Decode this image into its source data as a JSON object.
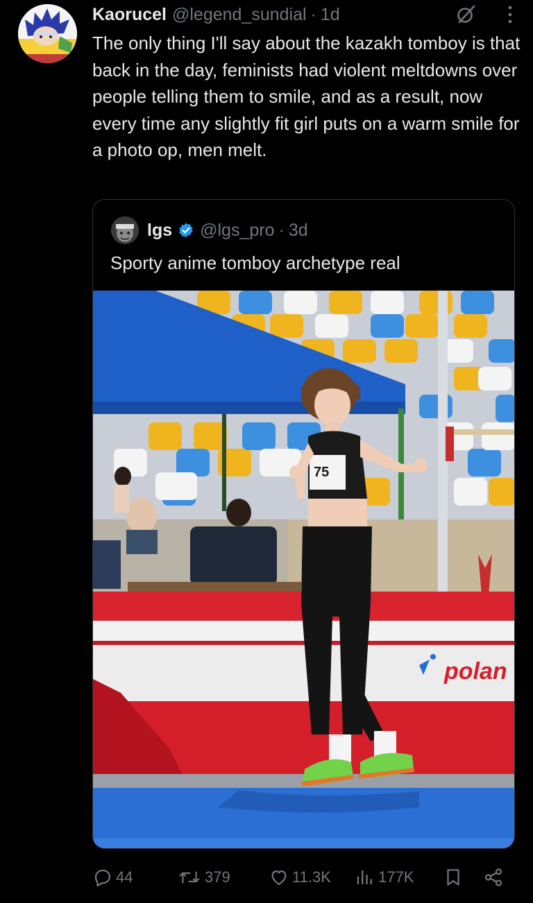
{
  "tweet": {
    "author_name": "Kaorucel",
    "author_handle": "@legend_sundial",
    "separator": "·",
    "time": "1d",
    "text": "The only thing I'll say about the kazakh tomboy is that back in the day, feminists had violent meltdowns over people telling them to smile, and as a result, now every time any slightly fit girl puts on a warm smile for a photo op, men melt."
  },
  "quote": {
    "author_name": "lgs",
    "author_handle": "@lgs_pro",
    "separator": "·",
    "time": "3d",
    "text": "Sporty anime tomboy archetype real",
    "media": {
      "bib_number": "75",
      "sponsor_text": "polan"
    }
  },
  "actions": {
    "replies": "44",
    "reposts": "379",
    "likes": "11.3K",
    "views": "177K"
  },
  "colors": {
    "background": "#000000",
    "text_primary": "#e7e9ea",
    "text_secondary": "#71767b",
    "border": "#2f3336",
    "verified_blue": "#1d9bf0"
  }
}
